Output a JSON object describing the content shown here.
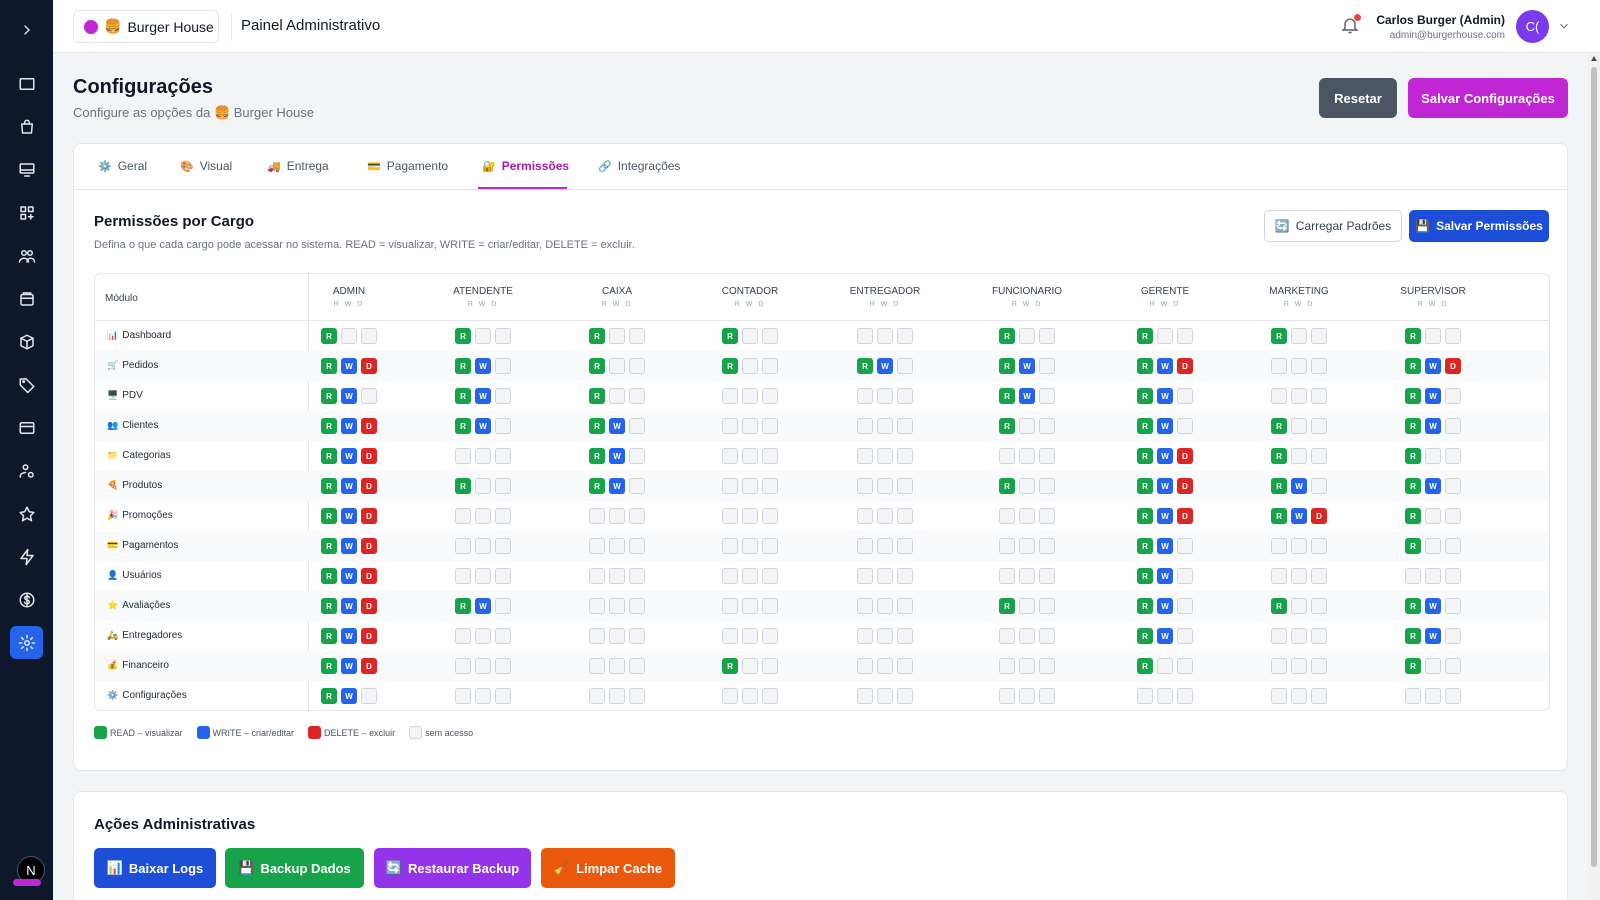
{
  "header": {
    "store_name": "Burger House",
    "store_emoji": "🍔",
    "title": "Painel Administrativo",
    "user_name": "Carlos Burger (Admin)",
    "user_email": "admin@burgerhouse.com",
    "avatar_initials": "C("
  },
  "sidebar": {
    "icons": [
      "folder-icon",
      "shopping-bag-icon",
      "monitor-icon",
      "grid-plus-icon",
      "users-icon",
      "layers-icon",
      "box-icon",
      "tag-icon",
      "credit-card-icon",
      "delivery-user-icon",
      "star-icon",
      "lightning-icon",
      "dollar-icon",
      "settings-icon"
    ],
    "active": "settings-icon",
    "bottom_avatar": "N"
  },
  "page": {
    "title": "Configurações",
    "subtitle_prefix": "Configure as opções da",
    "subtitle_emoji": "🍔",
    "subtitle_store": "Burger House",
    "reset_label": "Resetar",
    "save_label": "Salvar Configurações"
  },
  "tabs": [
    {
      "icon": "⚙️",
      "label": "Geral"
    },
    {
      "icon": "🎨",
      "label": "Visual"
    },
    {
      "icon": "🚚",
      "label": "Entrega"
    },
    {
      "icon": "💳",
      "label": "Pagamento"
    },
    {
      "icon": "🔐",
      "label": "Permissões"
    },
    {
      "icon": "🔗",
      "label": "Integrações"
    }
  ],
  "active_tab": "Permissões",
  "permissions": {
    "title": "Permissões por Cargo",
    "description": "Defina o que cada cargo pode acessar no sistema. READ = visualizar, WRITE = criar/editar, DELETE = excluir.",
    "load_defaults_label": "Carregar Padrões",
    "load_defaults_icon": "🔄",
    "save_label": "Salvar Permissões",
    "save_icon": "💾",
    "module_header": "Módulo",
    "rwd_caption": "R W D",
    "roles": [
      "ADMIN",
      "ATENDENTE",
      "CAIXA",
      "CONTADOR",
      "ENTREGADOR",
      "FUNCIONARIO",
      "GERENTE",
      "MARKETING",
      "SUPERVISOR"
    ],
    "modules": [
      {
        "icon": "📊",
        "name": "Dashboard",
        "perms": [
          "R",
          "R",
          "R",
          "R",
          "",
          "R",
          "R",
          "R",
          "R"
        ]
      },
      {
        "icon": "🛒",
        "name": "Pedidos",
        "perms": [
          "RWD",
          "RW",
          "R",
          "R",
          "RW",
          "RW",
          "RWD",
          "",
          "RWD"
        ]
      },
      {
        "icon": "🖥️",
        "name": "PDV",
        "perms": [
          "RW",
          "RW",
          "R",
          "",
          "",
          "RW",
          "RW",
          "",
          "RW"
        ]
      },
      {
        "icon": "👥",
        "name": "Clientes",
        "perms": [
          "RWD",
          "RW",
          "RW",
          "",
          "",
          "R",
          "RW",
          "R",
          "RW"
        ]
      },
      {
        "icon": "📁",
        "name": "Categorias",
        "perms": [
          "RWD",
          "",
          "RW",
          "",
          "",
          "",
          "RWD",
          "R",
          "R"
        ]
      },
      {
        "icon": "🍕",
        "name": "Produtos",
        "perms": [
          "RWD",
          "R",
          "RW",
          "",
          "",
          "R",
          "RWD",
          "RW",
          "RW"
        ]
      },
      {
        "icon": "🎉",
        "name": "Promoções",
        "perms": [
          "RWD",
          "",
          "",
          "",
          "",
          "",
          "RWD",
          "RWD",
          "R"
        ]
      },
      {
        "icon": "💳",
        "name": "Pagamentos",
        "perms": [
          "RWD",
          "",
          "",
          "",
          "",
          "",
          "RW",
          "",
          "R"
        ]
      },
      {
        "icon": "👤",
        "name": "Usuários",
        "perms": [
          "RWD",
          "",
          "",
          "",
          "",
          "",
          "RW",
          "",
          ""
        ]
      },
      {
        "icon": "⭐",
        "name": "Avaliações",
        "perms": [
          "RWD",
          "RW",
          "",
          "",
          "",
          "R",
          "RW",
          "R",
          "RW"
        ]
      },
      {
        "icon": "🛵",
        "name": "Entregadores",
        "perms": [
          "RWD",
          "",
          "",
          "",
          "",
          "",
          "RW",
          "",
          "RW"
        ]
      },
      {
        "icon": "💰",
        "name": "Financeiro",
        "perms": [
          "RWD",
          "",
          "",
          "R",
          "",
          "",
          "R",
          "",
          "R"
        ]
      },
      {
        "icon": "⚙️",
        "name": "Configurações",
        "perms": [
          "RW",
          "",
          "",
          "",
          "",
          "",
          "",
          "",
          ""
        ]
      }
    ],
    "legend": [
      {
        "key": "read",
        "label": "READ – visualizar",
        "color": "#16a34a"
      },
      {
        "key": "write",
        "label": "WRITE – criar/editar",
        "color": "#2563eb"
      },
      {
        "key": "delete",
        "label": "DELETE – excluir",
        "color": "#dc2626"
      },
      {
        "key": "none",
        "label": "sem acesso",
        "color": "#f3f4f6"
      }
    ]
  },
  "admin_actions": {
    "title": "Ações Administrativas",
    "buttons": [
      {
        "icon": "📊",
        "label": "Baixar Logs",
        "color": "#1d4ed8"
      },
      {
        "icon": "💾",
        "label": "Backup Dados",
        "color": "#16a34a"
      },
      {
        "icon": "🔄",
        "label": "Restaurar Backup",
        "color": "#9333ea"
      },
      {
        "icon": "🧹",
        "label": "Limpar Cache",
        "color": "#ea580c"
      }
    ]
  },
  "colors": {
    "accent": "#c026d3",
    "primary": "#1d4ed8",
    "sidebar": "#0f172a"
  }
}
